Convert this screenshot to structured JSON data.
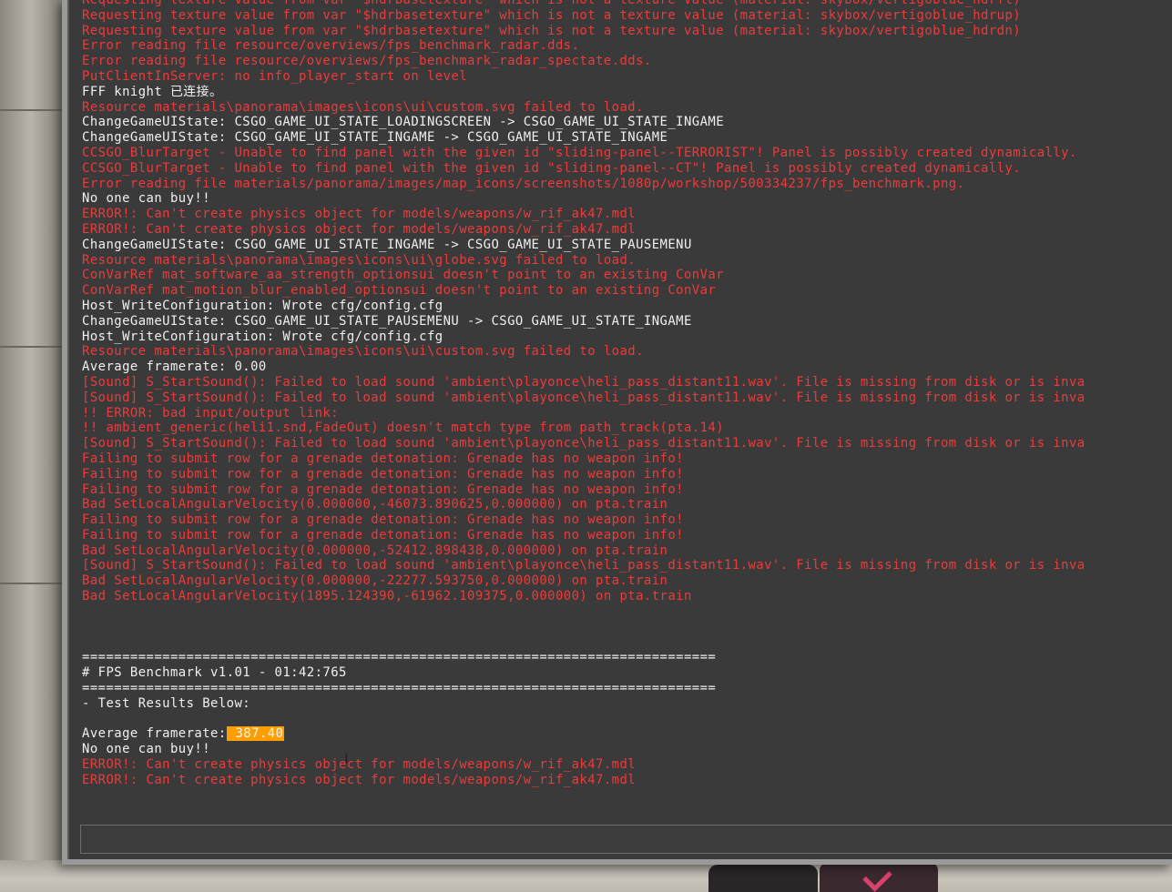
{
  "console": {
    "lines": [
      {
        "text": "Requesting texture value from var \"$hdrbasetexture\" which is not a texture value (material: skybox/vertigoblue_hdrft)",
        "color": "red"
      },
      {
        "text": "Requesting texture value from var \"$hdrbasetexture\" which is not a texture value (material: skybox/vertigoblue_hdrup)",
        "color": "red"
      },
      {
        "text": "Requesting texture value from var \"$hdrbasetexture\" which is not a texture value (material: skybox/vertigoblue_hdrdn)",
        "color": "red"
      },
      {
        "text": "Error reading file resource/overviews/fps_benchmark_radar.dds.",
        "color": "red"
      },
      {
        "text": "Error reading file resource/overviews/fps_benchmark_radar_spectate.dds.",
        "color": "red"
      },
      {
        "text": "PutClientInServer: no info_player_start on level",
        "color": "red"
      },
      {
        "text": "FFF knight 已连接。",
        "color": "white"
      },
      {
        "text": "Resource materials\\panorama\\images\\icons\\ui\\custom.svg failed to load.",
        "color": "red"
      },
      {
        "text": "ChangeGameUIState: CSGO_GAME_UI_STATE_LOADINGSCREEN -> CSGO_GAME_UI_STATE_INGAME",
        "color": "white"
      },
      {
        "text": "ChangeGameUIState: CSGO_GAME_UI_STATE_INGAME -> CSGO_GAME_UI_STATE_INGAME",
        "color": "white"
      },
      {
        "text": "CCSGO_BlurTarget - Unable to find panel with the given id \"sliding-panel--TERRORIST\"! Panel is possibly created dynamically.",
        "color": "red"
      },
      {
        "text": "CCSGO_BlurTarget - Unable to find panel with the given id \"sliding-panel--CT\"! Panel is possibly created dynamically.",
        "color": "red"
      },
      {
        "text": "Error reading file materials/panorama/images/map_icons/screenshots/1080p/workshop/500334237/fps_benchmark.png.",
        "color": "red"
      },
      {
        "text": "No one can buy!!",
        "color": "white"
      },
      {
        "text": "ERROR!: Can't create physics object for models/weapons/w_rif_ak47.mdl",
        "color": "red"
      },
      {
        "text": "ERROR!: Can't create physics object for models/weapons/w_rif_ak47.mdl",
        "color": "red"
      },
      {
        "text": "ChangeGameUIState: CSGO_GAME_UI_STATE_INGAME -> CSGO_GAME_UI_STATE_PAUSEMENU",
        "color": "white"
      },
      {
        "text": "Resource materials\\panorama\\images\\icons\\ui\\globe.svg failed to load.",
        "color": "red"
      },
      {
        "text": "ConVarRef mat_software_aa_strength_optionsui doesn't point to an existing ConVar",
        "color": "red"
      },
      {
        "text": "ConVarRef mat_motion_blur_enabled_optionsui doesn't point to an existing ConVar",
        "color": "red"
      },
      {
        "text": "Host_WriteConfiguration: Wrote cfg/config.cfg",
        "color": "white"
      },
      {
        "text": "ChangeGameUIState: CSGO_GAME_UI_STATE_PAUSEMENU -> CSGO_GAME_UI_STATE_INGAME",
        "color": "white"
      },
      {
        "text": "Host_WriteConfiguration: Wrote cfg/config.cfg",
        "color": "white"
      },
      {
        "text": "Resource materials\\panorama\\images\\icons\\ui\\custom.svg failed to load.",
        "color": "red"
      },
      {
        "text": "Average framerate: 0.00",
        "color": "white"
      },
      {
        "text": "[Sound] S_StartSound(): Failed to load sound 'ambient\\playonce\\heli_pass_distant11.wav'. File is missing from disk or is inva",
        "color": "red"
      },
      {
        "text": "[Sound] S_StartSound(): Failed to load sound 'ambient\\playonce\\heli_pass_distant11.wav'. File is missing from disk or is inva",
        "color": "red"
      },
      {
        "text": "!! ERROR: bad input/output link:",
        "color": "red"
      },
      {
        "text": "!! ambient_generic(heli1.snd,FadeOut) doesn't match type from path_track(pta.14)",
        "color": "red"
      },
      {
        "text": "[Sound] S_StartSound(): Failed to load sound 'ambient\\playonce\\heli_pass_distant11.wav'. File is missing from disk or is inva",
        "color": "red"
      },
      {
        "text": "Failing to submit row for a grenade detonation: Grenade has no weapon info!",
        "color": "red"
      },
      {
        "text": "Failing to submit row for a grenade detonation: Grenade has no weapon info!",
        "color": "red"
      },
      {
        "text": "Failing to submit row for a grenade detonation: Grenade has no weapon info!",
        "color": "red"
      },
      {
        "text": "Bad SetLocalAngularVelocity(0.000000,-46073.890625,0.000000) on pta.train",
        "color": "red"
      },
      {
        "text": "Failing to submit row for a grenade detonation: Grenade has no weapon info!",
        "color": "red"
      },
      {
        "text": "Failing to submit row for a grenade detonation: Grenade has no weapon info!",
        "color": "red"
      },
      {
        "text": "Bad SetLocalAngularVelocity(0.000000,-52412.898438,0.000000) on pta.train",
        "color": "red"
      },
      {
        "text": "[Sound] S_StartSound(): Failed to load sound 'ambient\\playonce\\heli_pass_distant11.wav'. File is missing from disk or is inva",
        "color": "red"
      },
      {
        "text": "Bad SetLocalAngularVelocity(0.000000,-22277.593750,0.000000) on pta.train",
        "color": "red"
      },
      {
        "text": "Bad SetLocalAngularVelocity(1895.124390,-61962.109375,0.000000) on pta.train",
        "color": "red"
      },
      {
        "text": "",
        "color": "white"
      },
      {
        "text": "",
        "color": "white"
      },
      {
        "text": "",
        "color": "white"
      },
      {
        "text": "===============================================================================",
        "color": "white"
      },
      {
        "text": "# FPS Benchmark v1.01 - 01:42:765",
        "color": "white"
      },
      {
        "text": "===============================================================================",
        "color": "white"
      },
      {
        "text": "- Test Results Below:",
        "color": "white"
      },
      {
        "text": "",
        "color": "white"
      },
      {
        "text": "Average framerate:",
        "color": "white",
        "highlight": " 387.40"
      },
      {
        "text": "No one can buy!!",
        "color": "white"
      },
      {
        "text": "ERROR!: Can't create physics object for models/weapons/w_rif_ak47.mdl",
        "color": "red"
      },
      {
        "text": "ERROR!: Can't create physics object for models/weapons/w_rif_ak47.mdl",
        "color": "red"
      }
    ],
    "input_value": ""
  },
  "colors": {
    "log_white": "#f0f0f0",
    "log_red": "#ec3b3b",
    "highlight": "#ff9e00",
    "console_bg": "#3a3a3a"
  }
}
